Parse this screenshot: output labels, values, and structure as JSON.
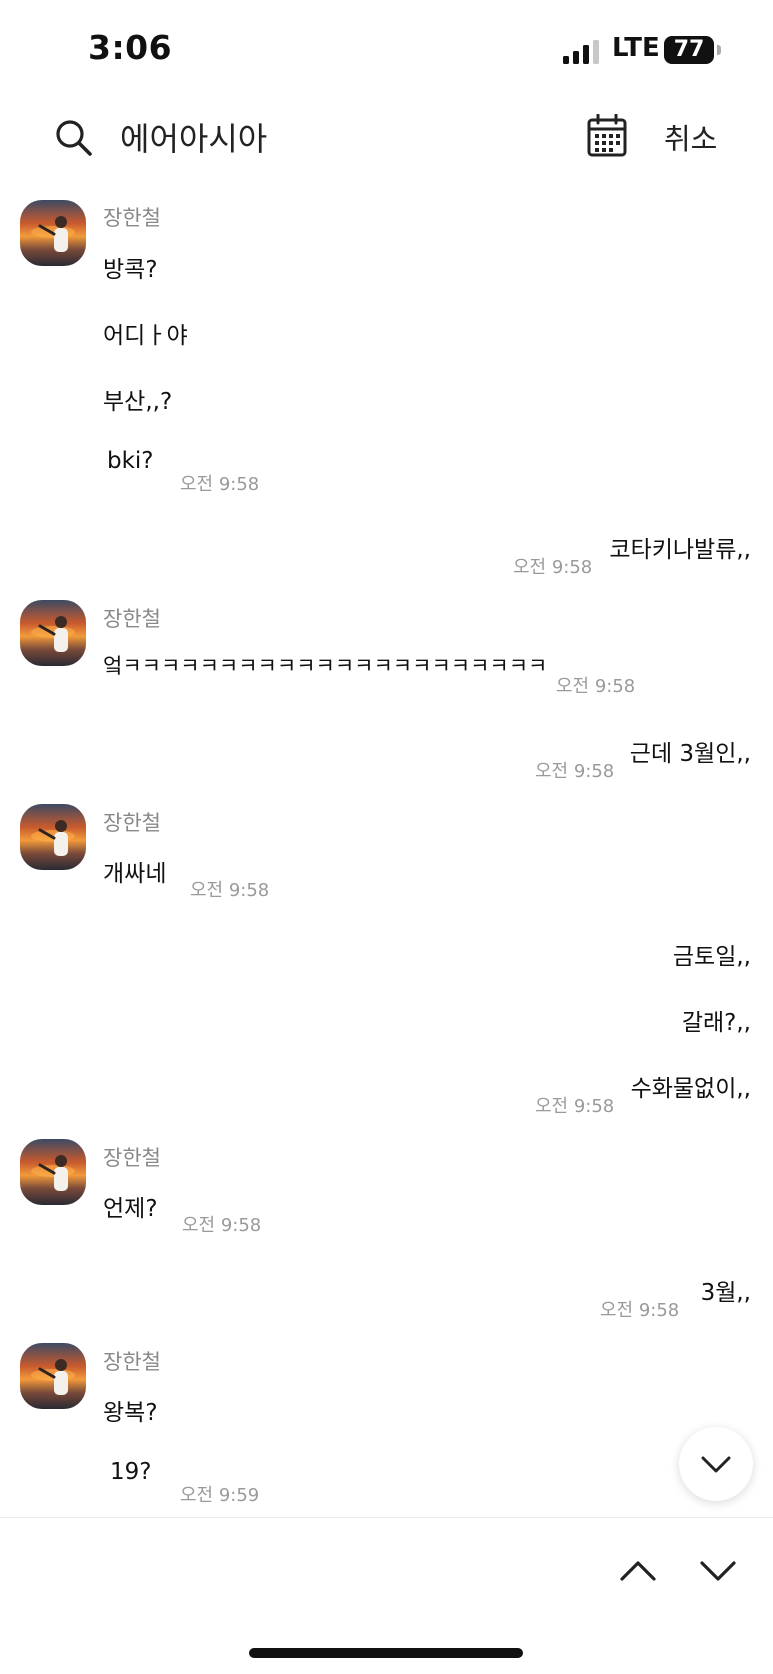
{
  "status_bar": {
    "time": "3:06",
    "network": "LTE",
    "battery": "77"
  },
  "search": {
    "query": "에어아시아",
    "cancel_label": "취소"
  },
  "messages": [
    {
      "sender": "장한철",
      "lines": [
        "방콕?",
        "어디ㅏ야",
        "부산,,?",
        "bki?"
      ],
      "time": "오전 9:58"
    },
    {
      "lines": [
        "코타키나발류,,"
      ],
      "time": "오전 9:58"
    },
    {
      "sender": "장한철",
      "lines": [
        "엌ㅋㅋㅋㅋㅋㅋㅋㅋㅋㅋㅋㅋㅋㅋㅋㅋㅋㅋㅋㅋㅋㅋ"
      ],
      "time": "오전 9:58"
    },
    {
      "lines": [
        "근데 3월인,,"
      ],
      "time": "오전 9:58"
    },
    {
      "sender": "장한철",
      "lines": [
        "개싸네"
      ],
      "time": "오전 9:58"
    },
    {
      "lines": [
        "금토일,,",
        "갈래?,,",
        "수화물없이,,"
      ],
      "time": "오전 9:58"
    },
    {
      "sender": "장한철",
      "lines": [
        "언제?"
      ],
      "time": "오전 9:58"
    },
    {
      "lines": [
        "3월,,"
      ],
      "time": "오전 9:58"
    },
    {
      "sender": "장한철",
      "lines": [
        "왕복?",
        "19?"
      ],
      "time": "오전 9:59"
    }
  ]
}
